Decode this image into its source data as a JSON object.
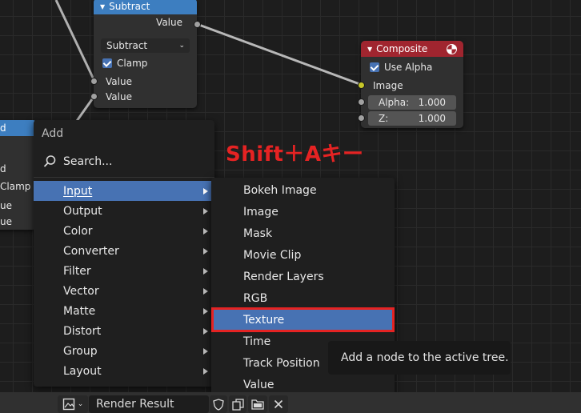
{
  "subtract_node": {
    "title": "Subtract",
    "output_label": "Value",
    "operation": "Subtract",
    "clamp_label": "Clamp",
    "inputs": [
      "Value",
      "Value"
    ]
  },
  "composite_node": {
    "title": "Composite",
    "use_alpha_label": "Use Alpha",
    "image_label": "Image",
    "alpha_label": "Alpha:",
    "alpha_value": "1.000",
    "z_label": "Z:",
    "z_value": "1.000"
  },
  "left_partial_node": {
    "header_fragment": "d",
    "rows": [
      "d",
      "Clamp",
      "ue",
      "ue"
    ]
  },
  "add_menu": {
    "title": "Add",
    "search": "Search...",
    "items": [
      "Input",
      "Output",
      "Color",
      "Converter",
      "Filter",
      "Vector",
      "Matte",
      "Distort",
      "Group",
      "Layout"
    ]
  },
  "input_submenu": {
    "items": [
      "Bokeh Image",
      "Image",
      "Mask",
      "Movie Clip",
      "Render Layers",
      "RGB",
      "Texture",
      "Time",
      "Track Position",
      "Value"
    ],
    "highlighted": "Texture"
  },
  "tooltip": "Add a node to the active tree.",
  "annotation": "Shift＋Aキー",
  "bottom_bar": {
    "image_name": "Render Result"
  },
  "colors": {
    "accent": "#4772b3",
    "subtract_header": "#3d7ec0",
    "composite_header": "#a0252f",
    "annotation_red": "#e52323"
  }
}
